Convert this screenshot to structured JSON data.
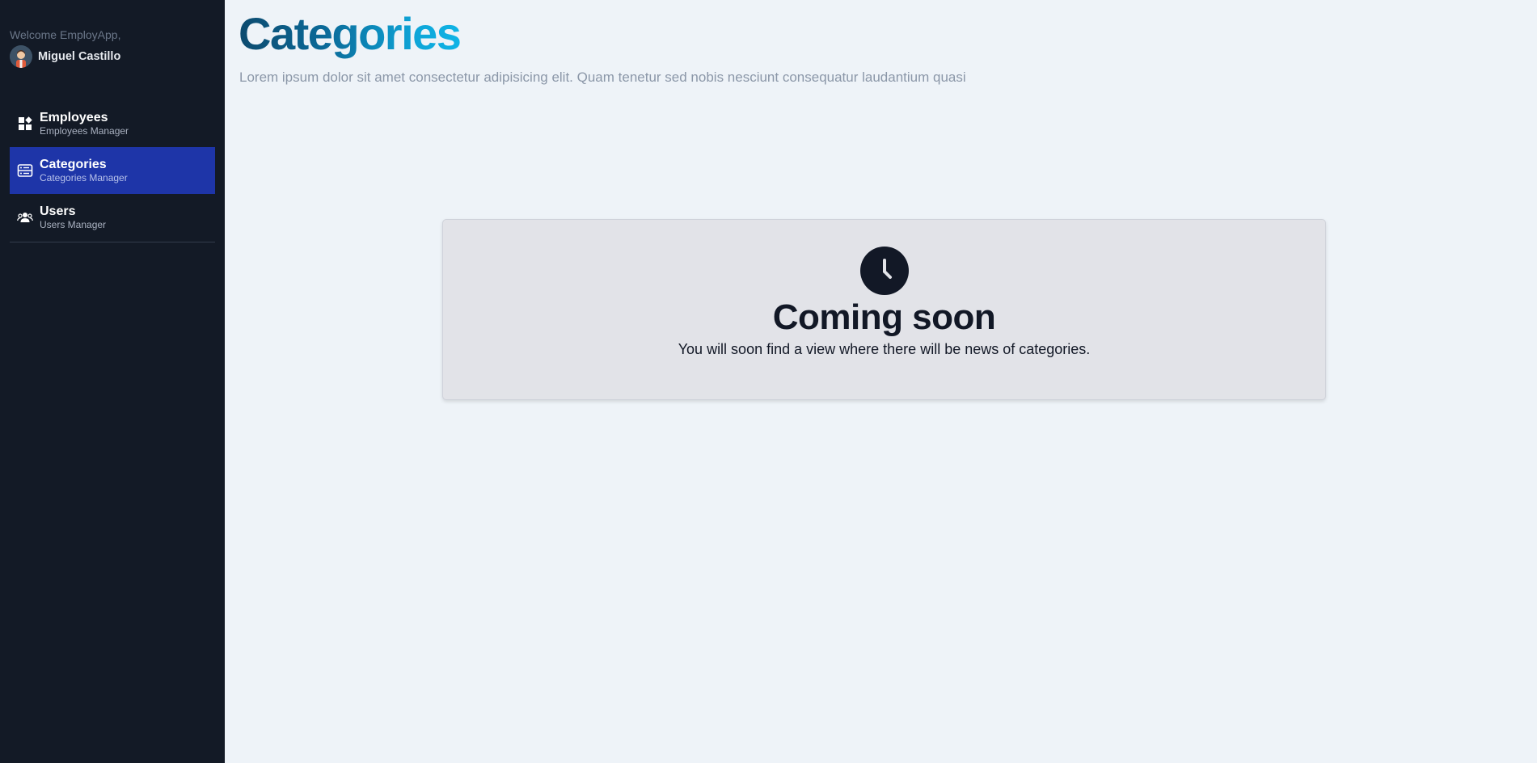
{
  "sidebar": {
    "welcome": "Welcome EmployApp,",
    "user_name": "Miguel Castillo",
    "items": [
      {
        "title": "Employees",
        "subtitle": "Employees Manager",
        "icon": "dashboard-icon"
      },
      {
        "title": "Categories",
        "subtitle": "Categories Manager",
        "icon": "list-icon"
      },
      {
        "title": "Users",
        "subtitle": "Users Manager",
        "icon": "users-icon"
      }
    ]
  },
  "main": {
    "title": "Categories",
    "description": "Lorem ipsum dolor sit amet consectetur adipisicing elit. Quam tenetur sed nobis nesciunt consequatur laudantium quasi"
  },
  "card": {
    "icon": "clock-icon",
    "title": "Coming soon",
    "text": "You will soon find a view where there will be news of categories."
  },
  "colors": {
    "sidebar_bg": "#131a26",
    "active_item": "#1e35a8",
    "page_bg": "#eef3f8",
    "card_bg": "#e2e3e8"
  }
}
